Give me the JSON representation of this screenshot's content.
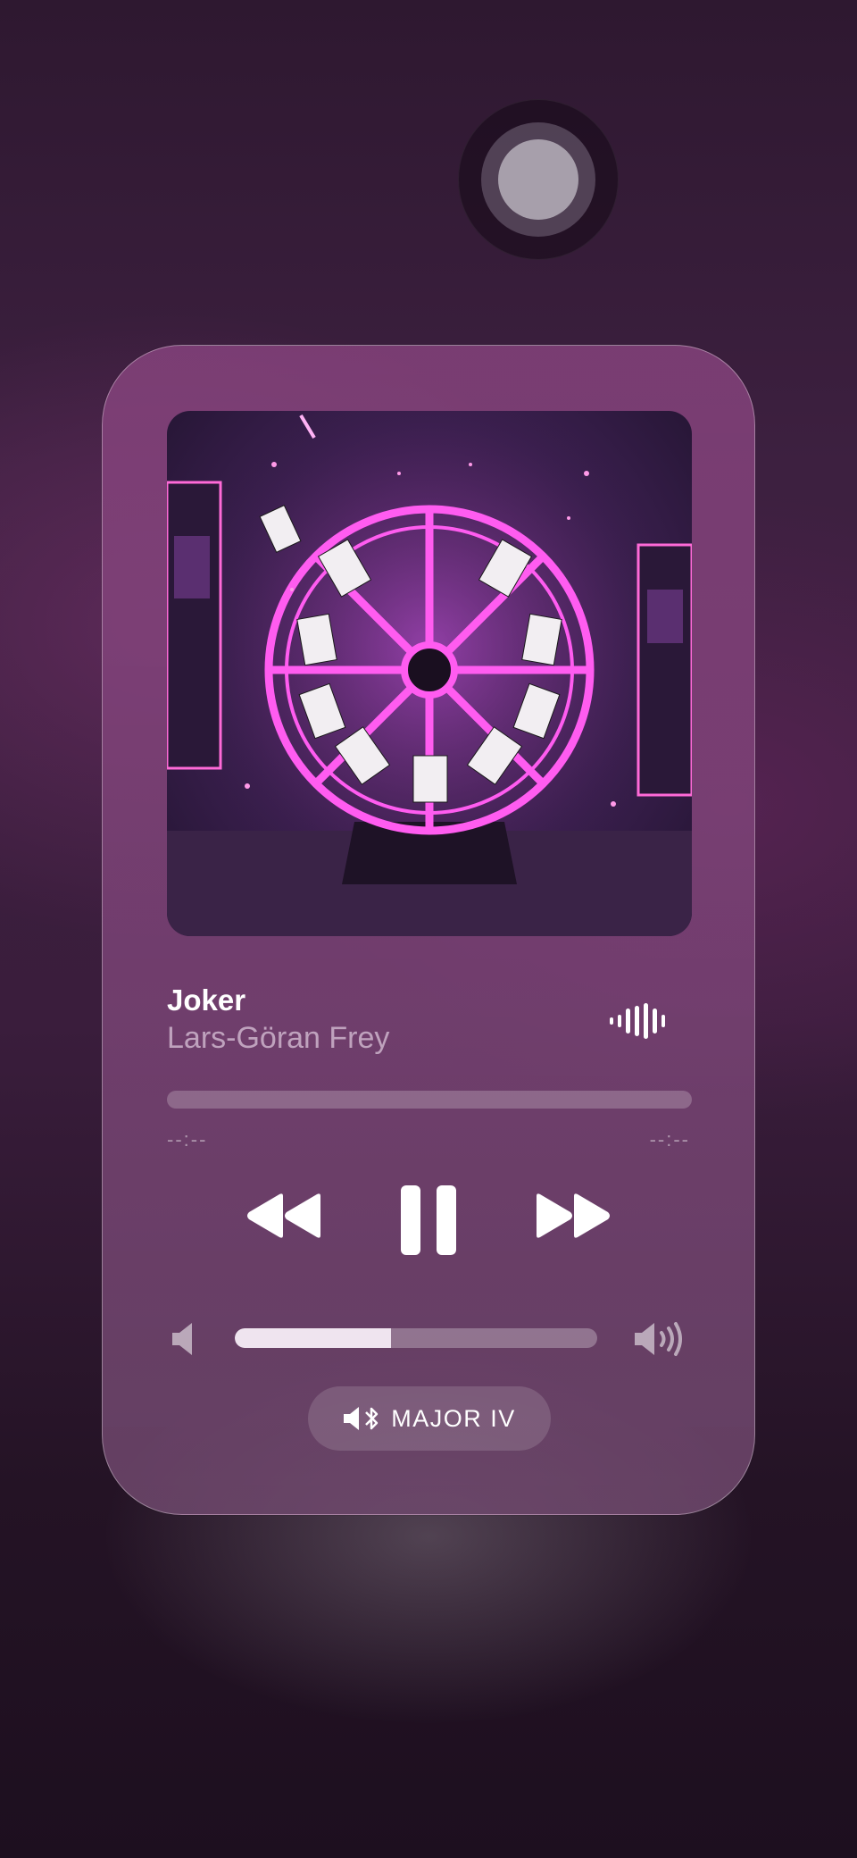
{
  "player": {
    "track_title": "Joker",
    "artist": "Lars-Göran Frey",
    "elapsed": "--:--",
    "remaining": "--:--",
    "volume_level": 0.43,
    "output_device": "MAJOR IV"
  },
  "icons": {
    "home": "assistive-touch-icon",
    "waveform": "waveform-icon",
    "rewind": "rewind-icon",
    "pause": "pause-icon",
    "forward": "fast-forward-icon",
    "volume_low": "speaker-low-icon",
    "volume_high": "speaker-high-icon",
    "device": "bluetooth-speaker-icon"
  },
  "colors": {
    "accent_neon": "#ff5cf0",
    "card_tint": "#8c4682"
  }
}
